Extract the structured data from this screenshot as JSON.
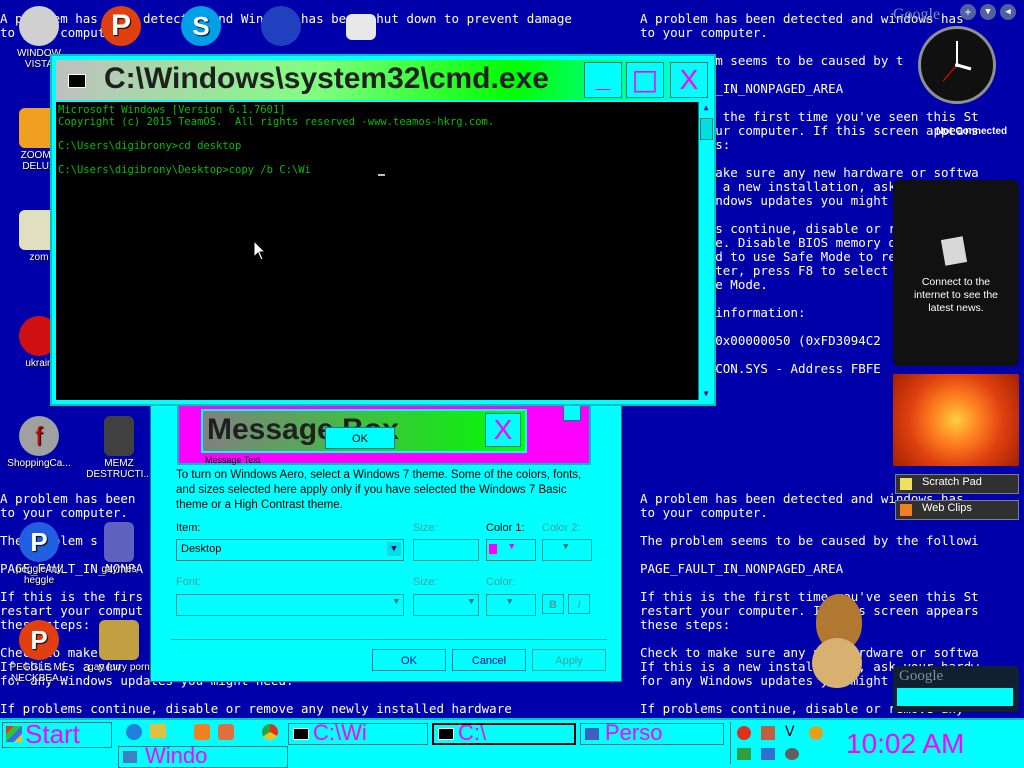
{
  "bsod": {
    "top_left": "A problem has been detected and Windows has been shut down to prevent damage\nto your computer.",
    "right_col": "A problem has been detected and windows has\nto your computer.\n\nThe problem seems to be caused by t\n\nPAGE_FAULT_IN_NONPAGED_AREA\n\nIf this is the first time you've seen this St\nrestart your computer. If this screen appears\nthese steps:\n\nCheck to make sure any new hardware or softwa\nIf this is a new installation, ask your hardw\nfor any Windows updates you might need.\n\nIf problems continue, disable or remove any\nor software. Disable BIOS memory options\nIf you need to use Safe Mode to remove\nyour computer, press F8 to select Adva\nselect Safe Mode.\n\nTechnical information:\n\n*** STOP: 0x00000050 (0xFD3094C2\n\n***  SPCMDCON.SYS - Address FBFE",
    "lower_right": "A problem has been detected and windows has\nto your computer.\n\nThe problem seems to be caused by the followi\n\nPAGE_FAULT_IN_NONPAGED_AREA\n\nIf this is the first time you've seen this St\nrestart your computer. If this screen appears\nthese steps:\n\nCheck to make sure any new hardware or softwa\nIf this is a new installation, ask your hardw\nfor any Windows updates you might need.\n\nIf problems continue, disable or remove any",
    "lower_left": "A problem has been\nto your computer.\n\nThe problem s\n\nPAGE_FAULT_IN_NONPA\n\nIf this is the firs\nrestart your comput\nthese steps:\n\nCheck to make\nIf this is a new\nfor any Windows updates you might need.\n\nIf problems continue, disable or remove any newly installed hardware"
  },
  "desktop_icons": [
    {
      "label": "WINDOW\nVISTA",
      "color": "#d0d0d0"
    },
    {
      "label": "ZOOMB\nDELUX",
      "color": "#f0a020"
    },
    {
      "label": "zom",
      "color": "#e0e0c0"
    },
    {
      "label": "ukrain",
      "color": "#d01010"
    },
    {
      "label": "ShoppingCa...",
      "color": "#a0a0a0"
    },
    {
      "label": "MEMZ\nDESTRUCTI...",
      "color": "#404040"
    },
    {
      "label": "peggle my\nheggle",
      "color": "#2060e0"
    },
    {
      "label": "gaymes",
      "color": "#6060c0"
    },
    {
      "label": "PEGGLE ME\nNECKBEA...",
      "color": "#e04010"
    },
    {
      "label": "gay furry porn",
      "color": "#c0a040"
    }
  ],
  "cmd": {
    "title": "C:\\Windows\\system32\\cmd.exe",
    "lines": [
      "Microsoft Windows [Version 6.1.7601]",
      "Copyright (c) 2015 TeamOS.  All rights reserved -www.teamos-hkrg.com.",
      "",
      "C:\\Users\\digibrony>cd desktop",
      "",
      "C:\\Users\\digibrony\\Desktop>copy /b C:\\Wi"
    ],
    "minimize": "_",
    "maximize": "□",
    "close": "X"
  },
  "msgbox": {
    "title": "Message Box",
    "ok": "OK",
    "close": "X",
    "sample_label": "Message Text"
  },
  "appearance": {
    "description": "To turn on Windows Aero, select a Windows 7 theme.  Some of the colors, fonts, and sizes selected here apply only if you have selected the Windows 7 Basic theme or a High Contrast theme.",
    "item_label": "Item:",
    "item_value": "Desktop",
    "size_label": "Size:",
    "color1_label": "Color 1:",
    "color2_label": "Color 2:",
    "font_label": "Font:",
    "size2_label": "Size:",
    "color_label": "Color:",
    "bold": "B",
    "italic": "I",
    "ok": "OK",
    "cancel": "Cancel",
    "apply": "Apply"
  },
  "gadgets": {
    "top_search": "Google",
    "clock_status": "Not Connected",
    "news": "Connect to the internet to see the latest news.",
    "scratch_pad": "Scratch Pad",
    "web_clips": "Web Clips",
    "bottom_search": "Google"
  },
  "taskbar": {
    "start": "Start",
    "items": [
      "C:\\Wi",
      "C:\\",
      "Perso",
      "Windo"
    ],
    "time": "10:02 AM"
  },
  "colors": {
    "bsod_blue": "#0000aa",
    "cyan": "#00ffff",
    "magenta": "#ff00ff",
    "taskbar": "#00ffff"
  }
}
